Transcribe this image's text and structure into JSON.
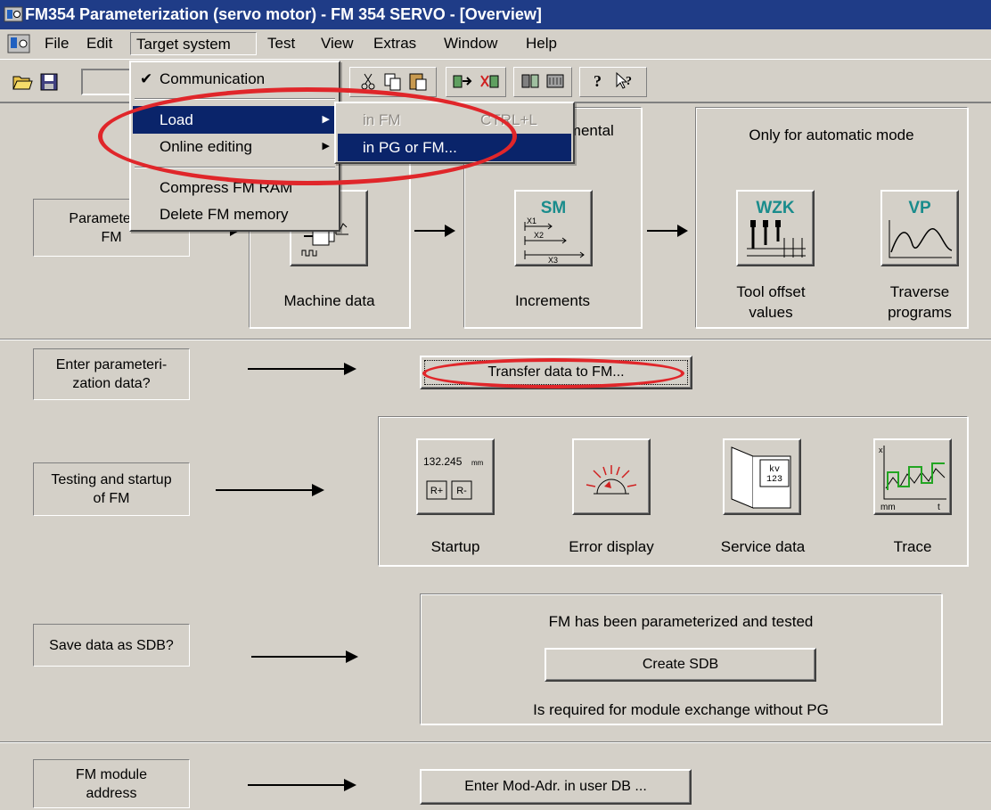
{
  "window": {
    "title": "FM354 Parameterization (servo motor) - FM 354 SERVO - [Overview]"
  },
  "menubar": {
    "items": [
      "File",
      "Edit",
      "Target system",
      "Test",
      "View",
      "Extras",
      "Window",
      "Help"
    ]
  },
  "target_menu": {
    "communication": "Communication",
    "load": "Load",
    "online_editing": "Online editing",
    "compress": "Compress FM RAM",
    "delete": "Delete FM memory"
  },
  "load_submenu": {
    "in_fm": "in FM",
    "in_fm_shortcut": "CTRL+L",
    "in_pg_or_fm": "in PG or FM..."
  },
  "workflow": {
    "parameterize_label": "Parameterize\nFM",
    "incremental_header": "Incremental",
    "automatic_header": "Only for automatic mode",
    "machine_data": "Machine data",
    "increments": "Increments",
    "increments_icon_text": "SM",
    "increments_rows": [
      "X1",
      "X2",
      "X3"
    ],
    "tool_offset": "Tool offset\nvalues",
    "tool_icon_text": "WZK",
    "traverse": "Traverse\nprograms",
    "traverse_icon_text": "VP",
    "enter_param_label": "Enter parameteri-\nzation data?",
    "transfer_button": "Transfer data to FM...",
    "testing_label": "Testing and startup\nof FM",
    "startup": "Startup",
    "startup_value": "132.245",
    "startup_unit": "mm",
    "startup_plus": "R+",
    "startup_minus": "R-",
    "error_display": "Error display",
    "service_data": "Service data",
    "service_icon_text": "kv\n123",
    "trace": "Trace",
    "trace_x": "x",
    "trace_mm": "mm",
    "trace_t": "t",
    "save_sdb_label": "Save data as SDB?",
    "sdb_header": "FM has been parameterized and tested",
    "create_sdb": "Create SDB",
    "sdb_note": "Is required for module exchange without PG",
    "module_address_label": "FM module\naddress",
    "enter_mod_adr": "Enter Mod-Adr. in user DB ..."
  },
  "colors": {
    "titlebar": "#1f3c87",
    "highlight": "#0a246a",
    "annotation": "#e0262a",
    "teal_icon_text": "#1a8c8c"
  }
}
